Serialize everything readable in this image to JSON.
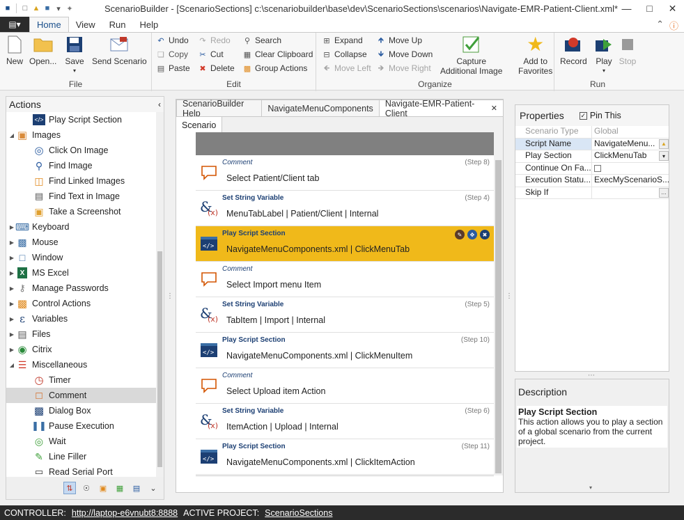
{
  "window": {
    "title": "ScenarioBuilder - [ScenarioSections] c:\\scenariobuilder\\base\\dev\\ScenarioSections\\scenarios\\Navigate-EMR-Patient-Client.xml*"
  },
  "menu": {
    "tabs": [
      "Home",
      "View",
      "Run",
      "Help"
    ]
  },
  "ribbon": {
    "file": {
      "label": "File",
      "new": "New",
      "open": "Open...",
      "save": "Save",
      "send": "Send Scenario"
    },
    "edit": {
      "label": "Edit",
      "undo": "Undo",
      "redo": "Redo",
      "copy": "Copy",
      "cut": "Cut",
      "paste": "Paste",
      "delete": "Delete",
      "search": "Search",
      "clear": "Clear Clipboard",
      "group": "Group Actions"
    },
    "organize": {
      "label": "Organize",
      "expand": "Expand",
      "collapse": "Collapse",
      "move_left": "Move Left",
      "move_up": "Move Up",
      "move_down": "Move Down",
      "move_right": "Move Right",
      "capture": "Capture\nAdditional Image",
      "capture_l1": "Capture",
      "capture_l2": "Additional Image",
      "fav_l1": "Add to",
      "fav_l2": "Favorites"
    },
    "run": {
      "label": "Run",
      "record": "Record",
      "play": "Play",
      "stop": "Stop"
    }
  },
  "actions": {
    "title": "Actions",
    "items": [
      {
        "label": "Play Script Section",
        "level": 1,
        "icon": "code-icon"
      },
      {
        "label": "Images",
        "level": 0,
        "icon": "images-icon"
      },
      {
        "label": "Click On Image",
        "level": 1,
        "icon": "click-target-icon"
      },
      {
        "label": "Find Image",
        "level": 1,
        "icon": "find-image-icon"
      },
      {
        "label": "Find Linked Images",
        "level": 1,
        "icon": "linked-images-icon"
      },
      {
        "label": "Find Text in Image",
        "level": 1,
        "icon": "text-image-icon"
      },
      {
        "label": "Take a Screenshot",
        "level": 1,
        "icon": "screenshot-icon"
      },
      {
        "label": "Keyboard",
        "level": 0,
        "icon": "keyboard-icon"
      },
      {
        "label": "Mouse",
        "level": 0,
        "icon": "mouse-icon"
      },
      {
        "label": "Window",
        "level": 0,
        "icon": "window-icon"
      },
      {
        "label": "MS Excel",
        "level": 0,
        "icon": "excel-icon"
      },
      {
        "label": "Manage Passwords",
        "level": 0,
        "icon": "key-icon"
      },
      {
        "label": "Control Actions",
        "level": 0,
        "icon": "box-icon"
      },
      {
        "label": "Variables",
        "level": 0,
        "icon": "variable-icon"
      },
      {
        "label": "Files",
        "level": 0,
        "icon": "file-icon"
      },
      {
        "label": "Citrix",
        "level": 0,
        "icon": "citrix-icon"
      },
      {
        "label": "Miscellaneous",
        "level": 0,
        "icon": "sliders-icon"
      },
      {
        "label": "Timer",
        "level": 1,
        "icon": "timer-icon"
      },
      {
        "label": "Comment",
        "level": 1,
        "icon": "comment-icon"
      },
      {
        "label": "Dialog Box",
        "level": 1,
        "icon": "dialog-icon"
      },
      {
        "label": "Pause Execution",
        "level": 1,
        "icon": "pause-icon"
      },
      {
        "label": "Wait",
        "level": 1,
        "icon": "wait-icon"
      },
      {
        "label": "Line Filler",
        "level": 1,
        "icon": "pen-icon"
      },
      {
        "label": "Read Serial Port",
        "level": 1,
        "icon": "serial-port-icon"
      }
    ]
  },
  "editor": {
    "tabs": [
      "ScenarioBuilder Help",
      "NavigateMenuComponents",
      "Navigate-EMR-Patient-Client"
    ],
    "subtab": "Scenario",
    "steps": [
      {
        "type": "Comment",
        "num": "(Step 8)",
        "text": "Select Patient/Client tab",
        "kind": "comment"
      },
      {
        "type": "Set String Variable",
        "num": "(Step 4)",
        "text": "MenuTabLabel  |  Patient/Client  |  Internal",
        "kind": "var"
      },
      {
        "type": "Play Script Section",
        "num": "",
        "text": "NavigateMenuComponents.xml  |  ClickMenuTab",
        "kind": "code",
        "highlight": true
      },
      {
        "type": "Comment",
        "num": "",
        "text": "Select Import menu Item",
        "kind": "comment"
      },
      {
        "type": "Set String Variable",
        "num": "(Step 5)",
        "text": "TabItem  |  Import  |  Internal",
        "kind": "var"
      },
      {
        "type": "Play Script Section",
        "num": "(Step 10)",
        "text": "NavigateMenuComponents.xml  |  ClickMenuItem",
        "kind": "code"
      },
      {
        "type": "Comment",
        "num": "",
        "text": "Select Upload item Action",
        "kind": "comment"
      },
      {
        "type": "Set String Variable",
        "num": "(Step 6)",
        "text": "ItemAction  |  Upload  |  Internal",
        "kind": "var"
      },
      {
        "type": "Play Script Section",
        "num": "(Step 11)",
        "text": "NavigateMenuComponents.xml  |  ClickItemAction",
        "kind": "code"
      }
    ]
  },
  "properties": {
    "title": "Properties",
    "pin": "Pin This",
    "rows": [
      {
        "key": "Scenario Type",
        "value": "Global",
        "disabled": true
      },
      {
        "key": "Script Name",
        "value": "NavigateMenu...",
        "button": "folder"
      },
      {
        "key": "Play Section",
        "value": "ClickMenuTab",
        "button": "dropdown"
      },
      {
        "key": "Continue On Fa...",
        "value": "",
        "checkbox": true
      },
      {
        "key": "Execution Statu...",
        "value": "ExecMyScenarioS..."
      },
      {
        "key": "Skip If",
        "value": "",
        "button": "ellipsis"
      }
    ]
  },
  "description": {
    "title": "Description",
    "heading": "Play Script Section",
    "body": "This action allows you to play a section of a global scenario from the current project."
  },
  "status": {
    "controller_label": "CONTROLLER:",
    "controller_url": "http://laptop-e6vnubt8:8888",
    "project_label": "ACTIVE PROJECT:",
    "project": "ScenarioSections"
  }
}
